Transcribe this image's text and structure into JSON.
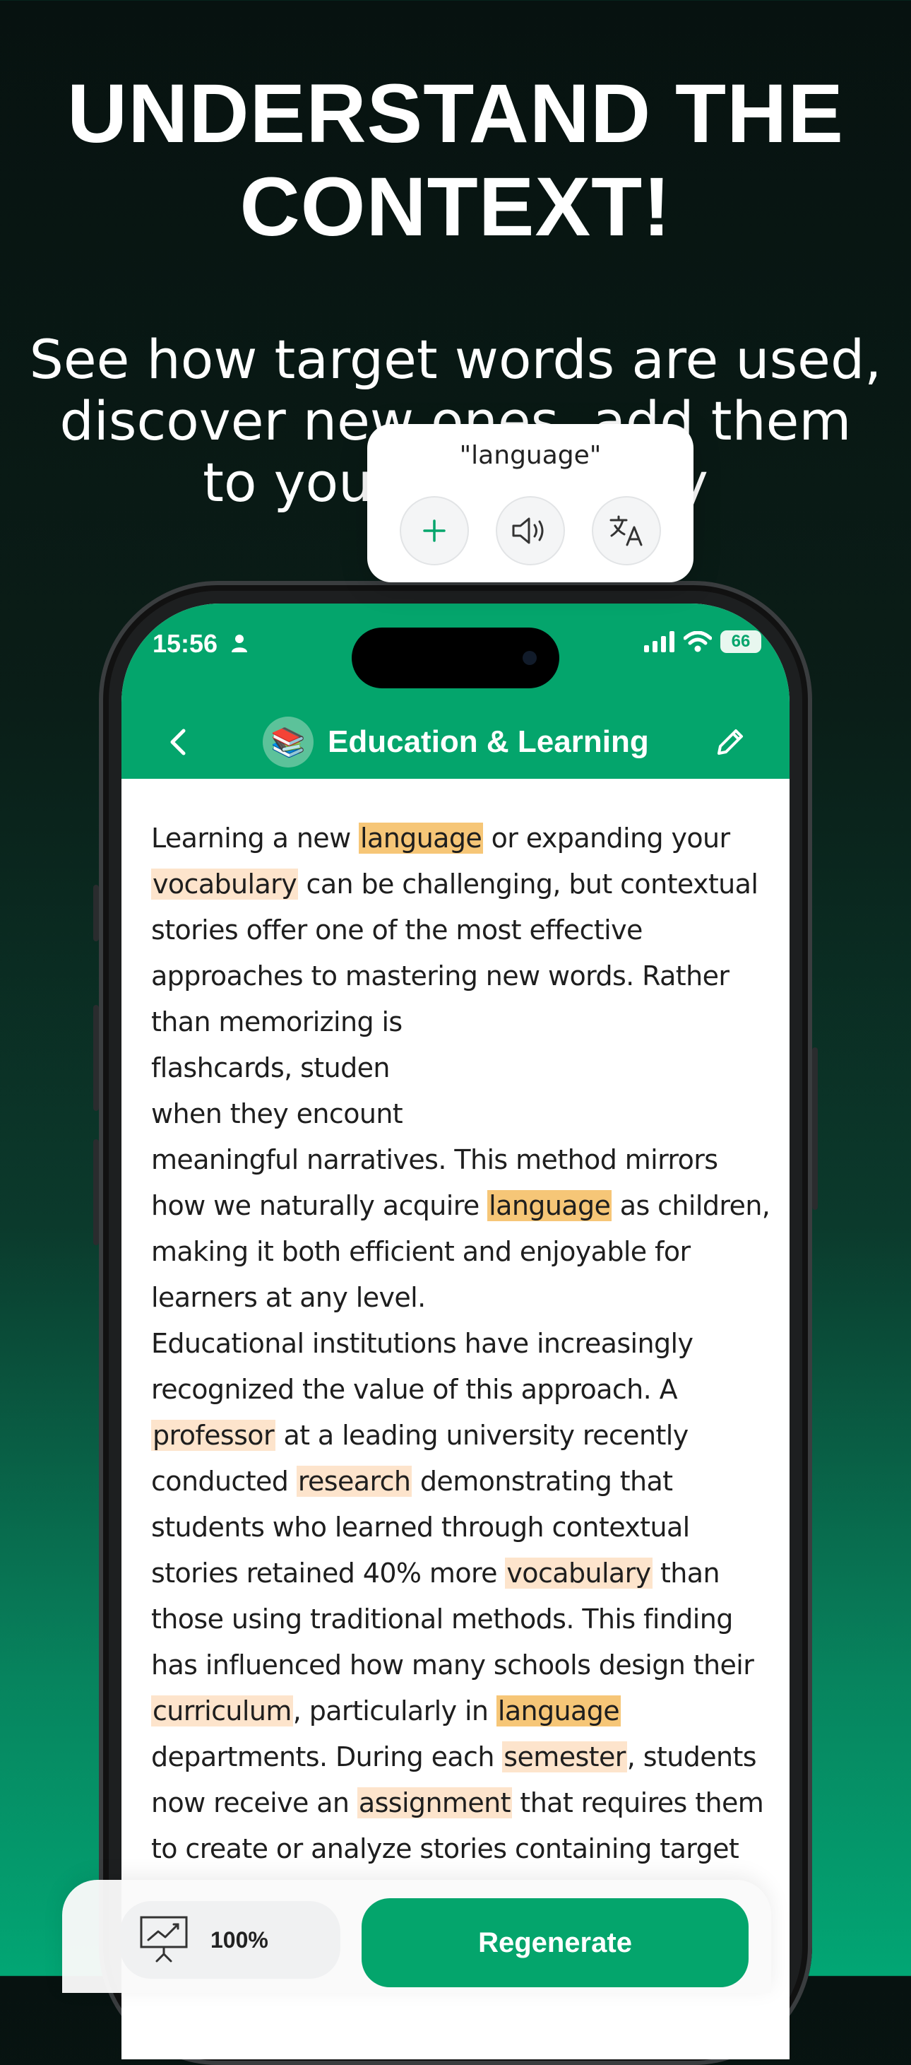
{
  "headline": "UNDERSTAND THE CONTEXT!",
  "subtitle": "See how target words are used, discover new ones, add them to your vocabulary",
  "status_bar": {
    "time": "15:56",
    "battery": "66"
  },
  "app_bar": {
    "title": "Education & Learning",
    "category_emoji": "📚"
  },
  "story": {
    "p1_a": "Learning a new ",
    "w_language_1": "language",
    "p1_b": " or expanding your ",
    "w_vocabulary_1": "vocabulary",
    "p1_c": " can be challenging, but contextual stories offer one of the most effective approaches to mastering new words. Rather than memorizing is",
    "p1_d": "flashcards, studen",
    "p1_e": "when they encount",
    "p1_f": "meaningful narratives. This method mirrors how we naturally acquire ",
    "w_language_2": "language",
    "p1_g": " as children, making it both efficient and enjoyable for learners at any level.",
    "p2_a": " Educational institutions have increasingly recognized the value of this approach. A ",
    "w_professor": "professor",
    "p2_b": " at a leading university recently conducted ",
    "w_research": "research",
    "p2_c": " demonstrating that students who learned through contextual stories retained 40% more ",
    "w_vocabulary_2": "vocabulary",
    "p2_d": " than those using traditional methods. This finding has influenced how many schools design their ",
    "w_curriculum": "curriculum",
    "p2_e": ", particularly in ",
    "w_language_3": "language",
    "p2_f": " departments. During each ",
    "w_semester": "semester",
    "p2_g": ", students now receive an ",
    "w_assignment": "assignment",
    "p2_h": " that requires them to create or analyze stories containing target"
  },
  "popup": {
    "word": "\"language\""
  },
  "bottom": {
    "zoom": "100%",
    "regenerate": "Regenerate"
  },
  "colors": {
    "brand": "#04a56c",
    "highlight_strong": "#f6c677",
    "highlight_light": "#fde4cc"
  }
}
